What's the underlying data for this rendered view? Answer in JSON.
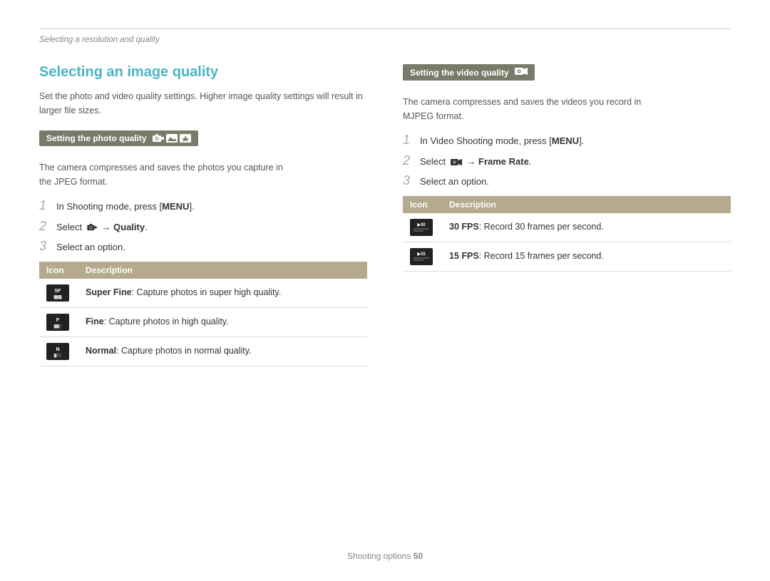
{
  "breadcrumb": {
    "text": "Selecting a resolution and quality"
  },
  "left": {
    "section_title": "Selecting an image quality",
    "section_intro": "Set the photo and video quality settings. Higher image quality settings will result in larger file sizes.",
    "photo_sub_header": "Setting the photo quality",
    "photo_intro_line1": "The camera compresses and saves the photos you capture in",
    "photo_intro_line2": "the JPEG format.",
    "step1_prefix": "In Shooting mode, press [",
    "step1_keyword": "MENU",
    "step1_suffix": "].",
    "step2_prefix": "Select",
    "step2_arrow": "→",
    "step2_keyword": "Quality",
    "step2_suffix": ".",
    "step3_text": "Select an option.",
    "table": {
      "col_icon": "Icon",
      "col_desc": "Description",
      "rows": [
        {
          "icon_label": "SF",
          "desc_bold": "Super Fine",
          "desc_rest": ": Capture photos in super high quality."
        },
        {
          "icon_label": "F",
          "desc_bold": "Fine",
          "desc_rest": ": Capture photos in high quality."
        },
        {
          "icon_label": "N",
          "desc_bold": "Normal",
          "desc_rest": ": Capture photos in normal quality."
        }
      ]
    }
  },
  "right": {
    "video_sub_header": "Setting the video quality",
    "video_intro_line1": "The camera compresses and saves the videos you record in",
    "video_intro_line2": "MJPEG format.",
    "step1_prefix": "In Video Shooting mode, press [",
    "step1_keyword": "MENU",
    "step1_suffix": "].",
    "step2_prefix": "Select",
    "step2_arrow": "→",
    "step2_keyword": "Frame Rate",
    "step2_suffix": ".",
    "step3_text": "Select an option.",
    "table": {
      "col_icon": "Icon",
      "col_desc": "Description",
      "rows": [
        {
          "icon_label": "30",
          "desc_bold": "30 FPS",
          "desc_rest": ": Record 30 frames per second."
        },
        {
          "icon_label": "15",
          "desc_bold": "15 FPS",
          "desc_rest": ": Record 15 frames per second."
        }
      ]
    }
  },
  "footer": {
    "text": "Shooting options",
    "page_number": "50"
  }
}
